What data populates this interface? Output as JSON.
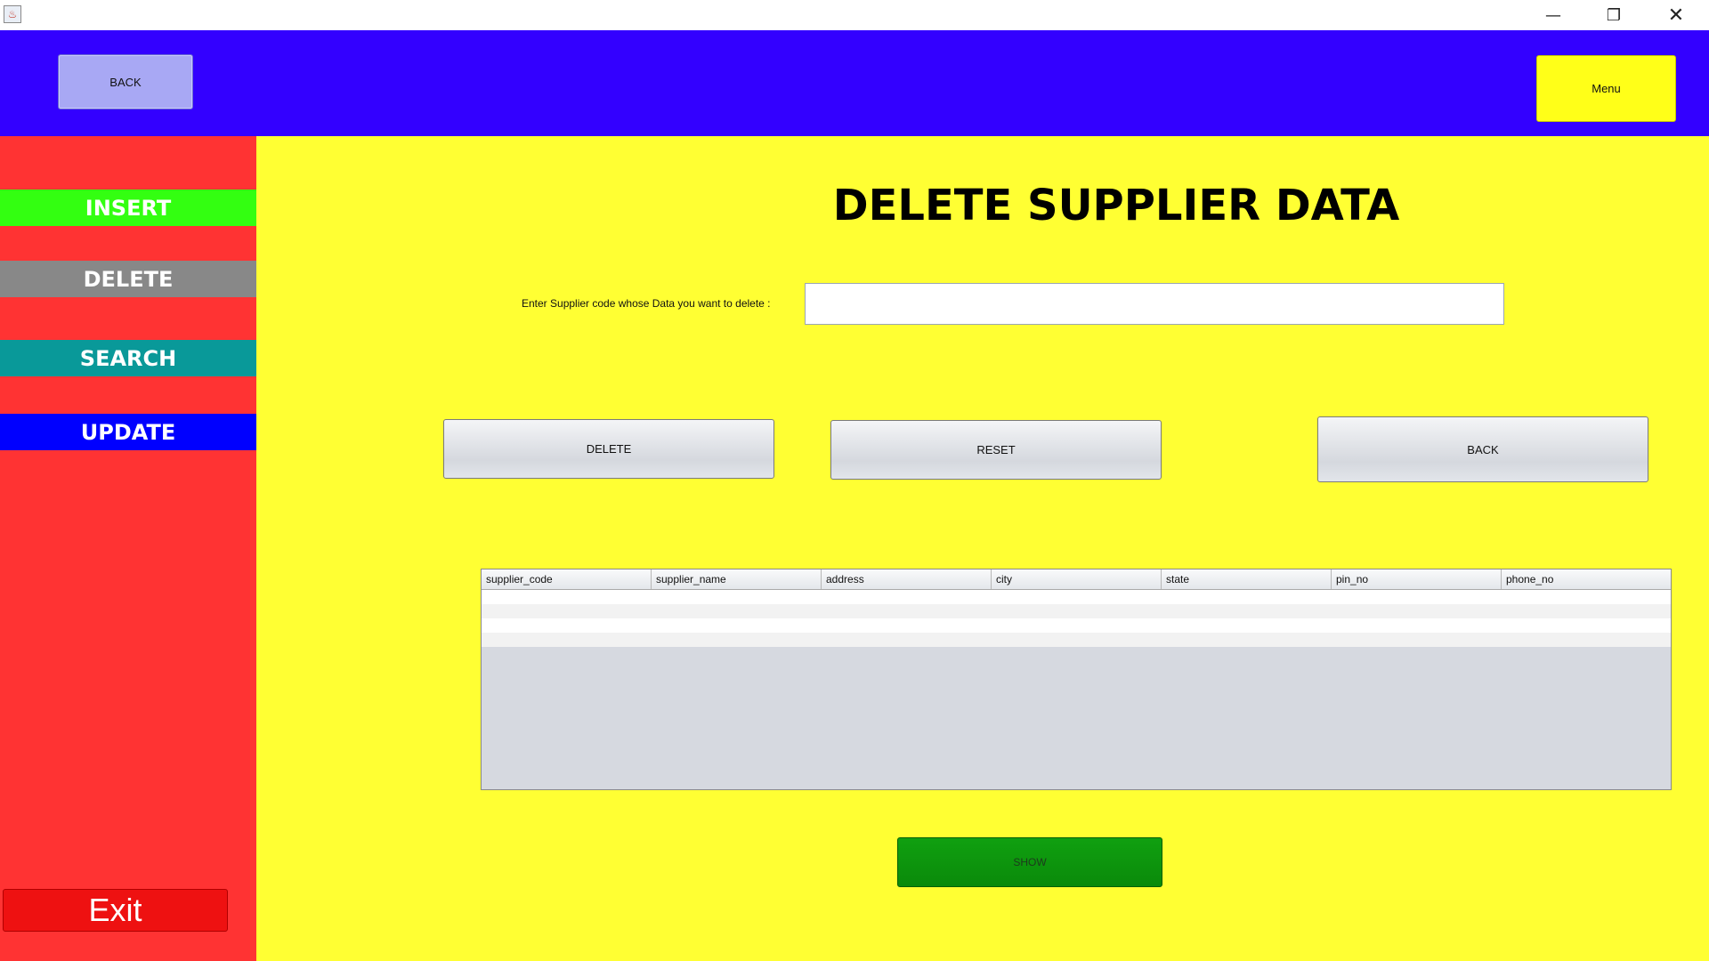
{
  "window": {
    "min_icon": "minimize-icon",
    "max_icon": "restore-icon",
    "close_icon": "close-icon",
    "min_glyph": "—",
    "max_glyph": "❐",
    "close_glyph": "✕"
  },
  "header": {
    "back_label": "BACK",
    "menu_label": "Menu"
  },
  "sidebar": {
    "items": [
      {
        "label": "INSERT",
        "color": "#33ff11"
      },
      {
        "label": "DELETE",
        "color": "#888888"
      },
      {
        "label": "SEARCH",
        "color": "#099999"
      },
      {
        "label": "UPDATE",
        "color": "#0000ff"
      }
    ],
    "exit_label": "Exit"
  },
  "main": {
    "title": "DELETE SUPPLIER DATA",
    "prompt_label": "Enter Supplier code whose Data you want to delete  :",
    "input_value": "",
    "buttons": {
      "delete": "DELETE",
      "reset": "RESET",
      "back": "BACK"
    },
    "table": {
      "columns": [
        "supplier_code",
        "supplier_name",
        "address",
        "city",
        "state",
        "pin_no",
        "phone_no"
      ],
      "rows": []
    },
    "show_label": "SHOW"
  },
  "colors": {
    "header_bg": "#3300ff",
    "sidebar_bg": "#ff3333",
    "main_bg": "#ffff33",
    "show_bg": "#0a8a0a",
    "exit_bg": "#ee1111"
  }
}
